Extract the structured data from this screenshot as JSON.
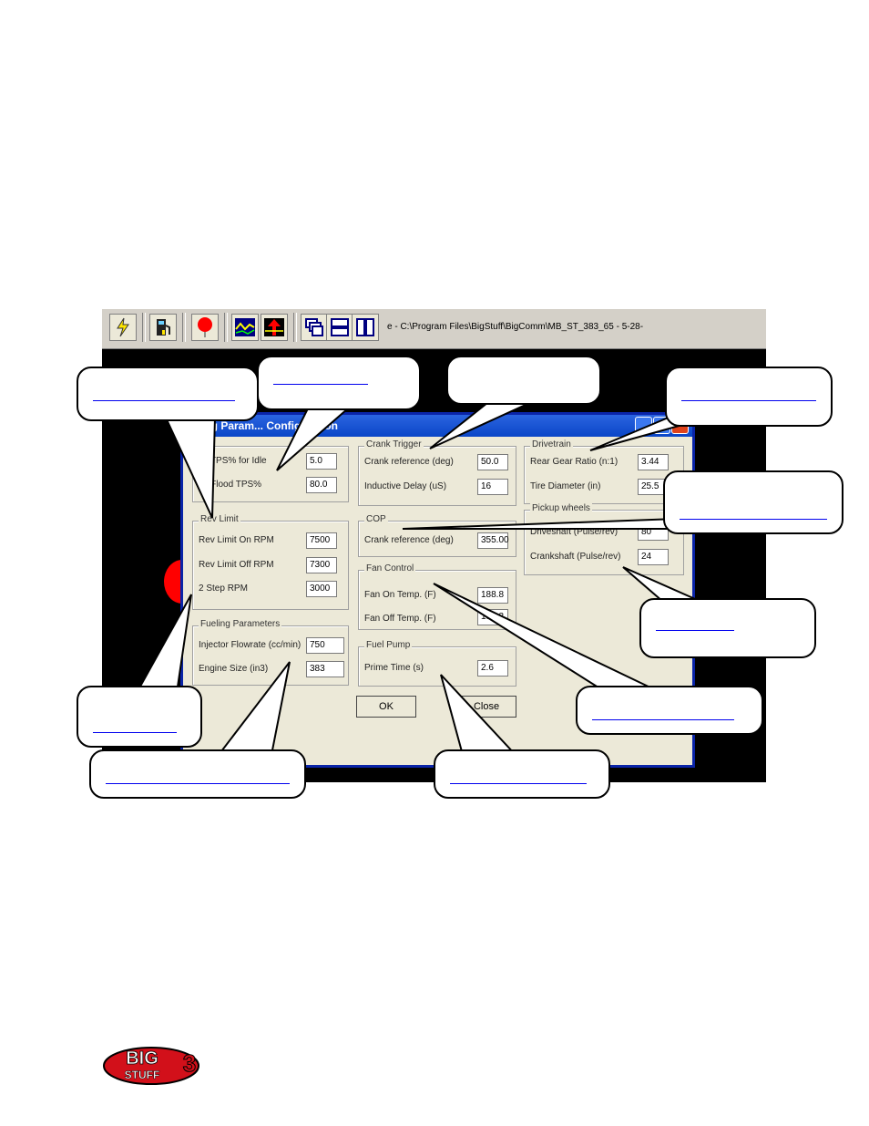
{
  "toolbar": {
    "path_text": "e - C:\\Program Files\\BigStuff\\BigComm\\MB_ST_383_65 - 5-28-",
    "icons": [
      "lightning-icon",
      "fuel-pump-icon",
      "balloon-icon",
      "graph-icon",
      "rpm-icon",
      "windows-cascade-icon",
      "windows-horizontal-icon",
      "windows-vertical-icon"
    ]
  },
  "dialog": {
    "title": "...ting Param... Configuration",
    "idle": {
      "tps_idle_label": "... TPS% for Idle",
      "tps_idle_value": "5.0",
      "flood_label": "... Flood TPS%",
      "flood_value": "80.0"
    },
    "rev_limit": {
      "title": "Rev Limit",
      "on_label": "Rev Limit On RPM",
      "on_value": "7500",
      "off_label": "Rev Limit Off RPM",
      "off_value": "7300",
      "step_label": "2 Step RPM",
      "step_value": "3000"
    },
    "fueling": {
      "title": "Fueling Parameters",
      "flow_label": "Injector Flowrate (cc/min)",
      "flow_value": "750",
      "size_label": "Engine Size (in3)",
      "size_value": "383"
    },
    "crank_trigger": {
      "title": "Crank Trigger",
      "ref_label": "Crank reference (deg)",
      "ref_value": "50.0",
      "delay_label": "Inductive Delay (uS)",
      "delay_value": "16"
    },
    "cop": {
      "title": "COP",
      "ref_label": "Crank reference (deg)",
      "ref_value": "355.00"
    },
    "fan_control": {
      "title": "Fan Control",
      "on_label": "Fan On Temp. (F)",
      "on_value": "188.8",
      "off_label": "Fan Off Temp. (F)",
      "off_value": "183.3"
    },
    "fuel_pump": {
      "title": "Fuel Pump",
      "prime_label": "Prime Time (s)",
      "prime_value": "2.6"
    },
    "drivetrain": {
      "title": "Drivetrain",
      "gear_label": "Rear Gear Ratio (n:1)",
      "gear_value": "3.44",
      "tire_label": "Tire Diameter (in)",
      "tire_value": "25.5"
    },
    "pickup_wheels": {
      "title": "Pickup wheels",
      "drive_label": "Driveshaft (Pulse/rev)",
      "drive_value": "80",
      "crank_label": "Crankshaft (Pulse/rev)",
      "crank_value": "24"
    },
    "ok_label": "OK",
    "close_label": "Close"
  },
  "colors": {
    "titlebar": "#0a46c8",
    "dialog_bg": "#ece9d8",
    "toolbar_bg": "#d4d0c8",
    "link": "#0000ee",
    "logo_red": "#d2101a"
  },
  "logo": {
    "line1": "BIG",
    "line2": "STUFF",
    "digit": "3"
  }
}
